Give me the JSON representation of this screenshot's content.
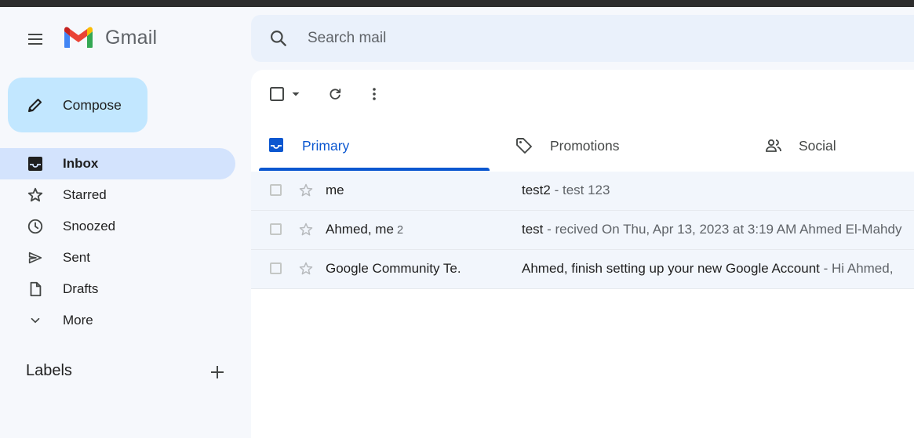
{
  "app": {
    "name": "Gmail"
  },
  "search": {
    "placeholder": "Search mail"
  },
  "compose": {
    "label": "Compose"
  },
  "nav": {
    "items": [
      {
        "label": "Inbox",
        "icon": "inbox-icon",
        "active": true
      },
      {
        "label": "Starred",
        "icon": "star-icon"
      },
      {
        "label": "Snoozed",
        "icon": "clock-icon"
      },
      {
        "label": "Sent",
        "icon": "send-icon"
      },
      {
        "label": "Drafts",
        "icon": "file-icon"
      },
      {
        "label": "More",
        "icon": "chevron-down-icon"
      }
    ]
  },
  "labels": {
    "title": "Labels"
  },
  "tabs": [
    {
      "label": "Primary",
      "icon": "inbox-icon",
      "active": true
    },
    {
      "label": "Promotions",
      "icon": "tag-icon"
    },
    {
      "label": "Social",
      "icon": "people-icon"
    }
  ],
  "emails": [
    {
      "sender": "me",
      "count": "",
      "subject": "test2",
      "separator": " - ",
      "snippet": "test 123"
    },
    {
      "sender": "Ahmed, me",
      "count": "2",
      "subject": "test",
      "separator": " - ",
      "snippet": "recived On Thu, Apr 13, 2023 at 3:19 AM Ahmed El-Mahdy"
    },
    {
      "sender": "Google Community Te.",
      "count": "",
      "subject": "Ahmed, finish setting up your new Google Account",
      "separator": " - ",
      "snippet": "Hi Ahmed,"
    }
  ],
  "colors": {
    "accent": "#0b57d0",
    "compose_bg": "#c2e7ff",
    "active_nav_bg": "#d3e3fd",
    "search_bg": "#eaf1fb",
    "page_bg": "#f6f8fc"
  }
}
